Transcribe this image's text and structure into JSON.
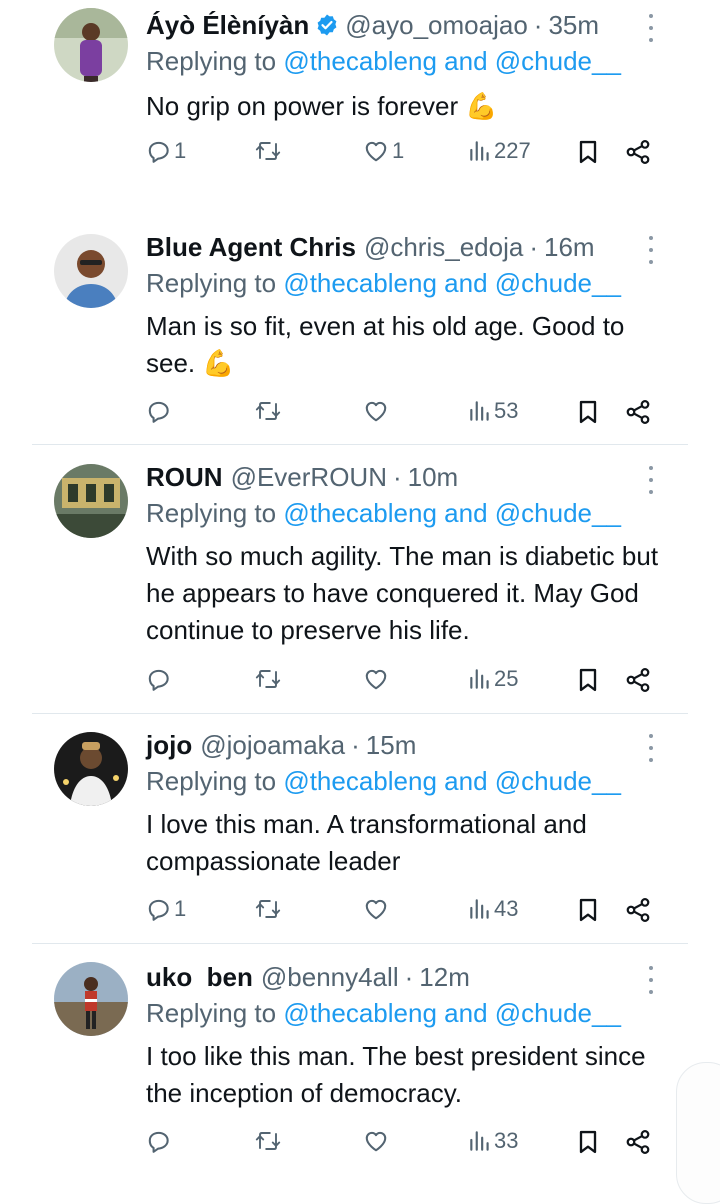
{
  "tweets": [
    {
      "name": "Áyò Élèníyàn",
      "verified": true,
      "handle": "@ayo_omoajao",
      "time": "35m",
      "replying_prefix": "Replying to ",
      "mention1": "@thecableng",
      "mention_and": " and ",
      "mention2": "@chude__",
      "text": "No grip on power is forever 💪",
      "replies": "1",
      "reposts": "",
      "likes": "1",
      "views": "227"
    },
    {
      "name": "Blue Agent Chris",
      "verified": false,
      "handle": "@chris_edoja",
      "time": "16m",
      "replying_prefix": "Replying to ",
      "mention1": "@thecableng",
      "mention_and": " and ",
      "mention2": "@chude__",
      "text": "Man is so fit, even at his old age. Good to see. 💪",
      "replies": "",
      "reposts": "",
      "likes": "",
      "views": "53"
    },
    {
      "name": "ROUN",
      "verified": false,
      "handle": "@EverROUN",
      "time": "10m",
      "replying_prefix": "Replying to ",
      "mention1": "@thecableng",
      "mention_and": " and ",
      "mention2": "@chude__",
      "text": "With so much agility. The man is diabetic but he appears to have conquered it. May God continue to preserve his life.",
      "replies": "",
      "reposts": "",
      "likes": "",
      "views": "25"
    },
    {
      "name": "jojo",
      "verified": false,
      "handle": "@jojoamaka",
      "time": "15m",
      "replying_prefix": "Replying to ",
      "mention1": "@thecableng",
      "mention_and": " and ",
      "mention2": "@chude__",
      "text": "I love this man. A transformational and compassionate leader",
      "replies": "1",
      "reposts": "",
      "likes": "",
      "views": "43"
    },
    {
      "name": "uko  ben",
      "verified": false,
      "handle": "@benny4all",
      "time": "12m",
      "replying_prefix": "Replying to ",
      "mention1": "@thecableng",
      "mention_and": " and ",
      "mention2": "@chude__",
      "text": "I too like this man. The best president since the inception of democracy.",
      "replies": "",
      "reposts": "",
      "likes": "",
      "views": "33"
    }
  ],
  "separator": "·",
  "colors": {
    "text": "#0f1419",
    "secondary": "#536471",
    "mention": "#1d9bf0",
    "verified": "#1d9bf0",
    "divider": "#e1e8ed"
  },
  "icons": [
    "reply-icon",
    "repost-icon",
    "like-icon",
    "views-icon",
    "bookmark-icon",
    "share-icon",
    "verified-icon",
    "more-icon"
  ]
}
